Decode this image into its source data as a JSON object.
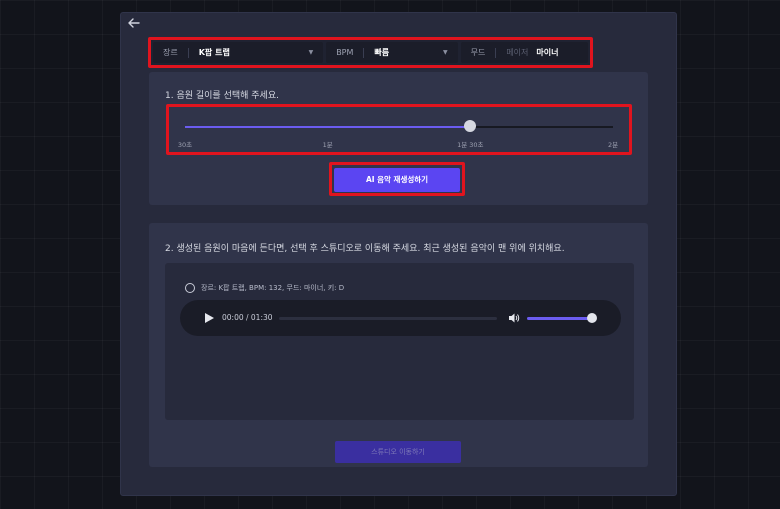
{
  "filters": {
    "genre": {
      "label": "장르",
      "value": "K팝 트랩"
    },
    "bpm": {
      "label": "BPM",
      "value": "빠름"
    },
    "mood": {
      "label": "무드",
      "option_inactive": "메이저",
      "option_active": "마이너"
    }
  },
  "step1": {
    "title": "1. 음원 길이를 선택해 주세요.",
    "slider": {
      "ticks": [
        "30초",
        "1분",
        "1분 30초",
        "2분"
      ],
      "selected": "1분 30초",
      "selected_fraction": 0.667
    },
    "regenerate_label": "AI 음악 재생성하기"
  },
  "step2": {
    "title": "2. 생성된 음원이 마음에 든다면, 선택 후 스튜디오로 이동해 주세요. 최근 생성된 음악이 맨 위에 위치해요.",
    "results": [
      {
        "description": "장르: K팝 트랩, BPM: 132, 무드: 마이너, 키: D",
        "time": "00:00 / 01:30",
        "progress": 0,
        "volume": 0.9
      }
    ],
    "studio_button_label": "스튜디오 이동하기"
  },
  "colors": {
    "accent": "#5b45f2",
    "highlight": "#e0141e",
    "panel": "#272a3c"
  },
  "icons": {
    "back": "arrow-left-icon",
    "play": "play-icon",
    "volume": "volume-icon",
    "caret": "caret-down-icon"
  }
}
